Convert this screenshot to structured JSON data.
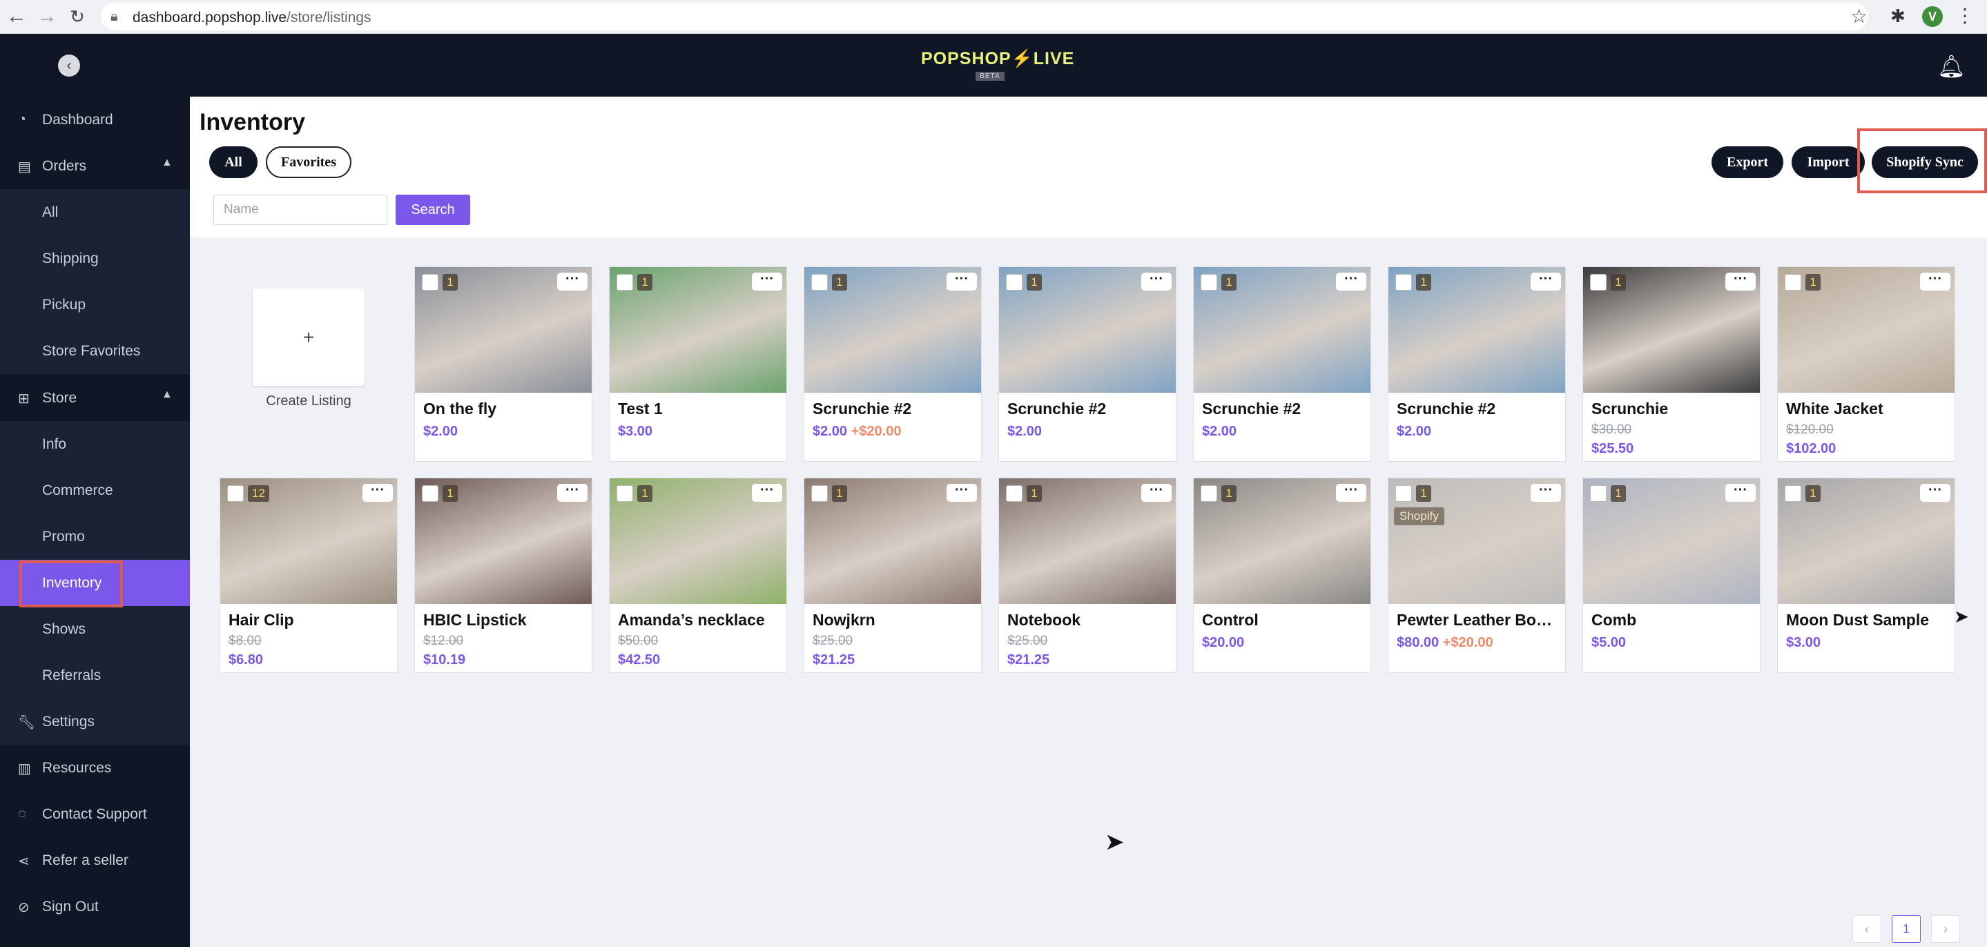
{
  "browser": {
    "url_host": "dashboard.popshop.live",
    "url_path": "/store/listings",
    "profile_initial": "V"
  },
  "header": {
    "logo_text": "POPSHOP⚡LIVE",
    "logo_beta": "BETA"
  },
  "sidebar": {
    "items": [
      {
        "label": "Dashboard",
        "icon": "gauge-icon"
      },
      {
        "label": "Orders",
        "icon": "receipt-icon"
      },
      {
        "label": "All"
      },
      {
        "label": "Shipping"
      },
      {
        "label": "Pickup"
      },
      {
        "label": "Store Favorites"
      },
      {
        "label": "Store",
        "icon": "grid-icon"
      },
      {
        "label": "Info"
      },
      {
        "label": "Commerce"
      },
      {
        "label": "Promo"
      },
      {
        "label": "Inventory"
      },
      {
        "label": "Shows"
      },
      {
        "label": "Referrals"
      },
      {
        "label": "Settings",
        "icon": "wrench-icon"
      },
      {
        "label": "Resources",
        "icon": "book-icon"
      },
      {
        "label": "Contact Support",
        "icon": "chat-icon"
      },
      {
        "label": "Refer a seller",
        "icon": "share-icon"
      },
      {
        "label": "Sign Out",
        "icon": "signout-icon"
      }
    ],
    "active": "Inventory"
  },
  "main": {
    "title": "Inventory",
    "filters": {
      "all": "All",
      "favorites": "Favorites"
    },
    "actions": {
      "export": "Export",
      "import": "Import",
      "shopify_sync": "Shopify Sync"
    },
    "search": {
      "placeholder": "Name",
      "button": "Search"
    },
    "create_label": "Create Listing",
    "create_symbol": "+"
  },
  "listings": [
    {
      "title": "On the fly",
      "qty": "1",
      "price": "$2.00",
      "img": "#8a8f9a"
    },
    {
      "title": "Test 1",
      "qty": "1",
      "price": "$3.00",
      "img": "#6aa46e"
    },
    {
      "title": "Scrunchie #2",
      "qty": "1",
      "price": "$2.00",
      "extra": "+$20.00",
      "img": "#7fa3c4"
    },
    {
      "title": "Scrunchie #2",
      "qty": "1",
      "price": "$2.00",
      "img": "#7fa3c4"
    },
    {
      "title": "Scrunchie #2",
      "qty": "1",
      "price": "$2.00",
      "img": "#7fa3c4"
    },
    {
      "title": "Scrunchie #2",
      "qty": "1",
      "price": "$2.00",
      "img": "#7fa3c4"
    },
    {
      "title": "Scrunchie",
      "qty": "1",
      "old_price": "$30.00",
      "price": "$25.50",
      "img": "#3b3b3d"
    },
    {
      "title": "White Jacket",
      "qty": "1",
      "old_price": "$120.00",
      "price": "$102.00",
      "img": "#b6a998"
    },
    {
      "title": "Hair Clip",
      "qty": "12",
      "old_price": "$8.00",
      "price": "$6.80",
      "img": "#9c8f82"
    },
    {
      "title": "HBIC Lipstick",
      "qty": "1",
      "old_price": "$12.00",
      "price": "$10.19",
      "img": "#6e5a56"
    },
    {
      "title": "Amanda’s necklace",
      "qty": "1",
      "old_price": "$50.00",
      "price": "$42.50",
      "img": "#8fb16a"
    },
    {
      "title": "Nowjkrn",
      "qty": "1",
      "old_price": "$25.00",
      "price": "$21.25",
      "img": "#8c7a72"
    },
    {
      "title": "Notebook",
      "qty": "1",
      "old_price": "$25.00",
      "price": "$21.25",
      "img": "#7d6f6a"
    },
    {
      "title": "Control",
      "qty": "1",
      "price": "$20.00",
      "img": "#8a8784"
    },
    {
      "title": "Pewter Leather Bow...",
      "qty": "1",
      "price": "$80.00",
      "extra": "+$20.00",
      "badge": "Shopify",
      "img": "#bdbcbb"
    },
    {
      "title": "Comb",
      "qty": "1",
      "price": "$5.00",
      "img": "#aeb4c4"
    },
    {
      "title": "Moon Dust Sample",
      "qty": "1",
      "price": "$3.00",
      "img": "#a7a6a9"
    }
  ],
  "pagination": {
    "prev": "‹",
    "current": "1",
    "next": "›"
  }
}
